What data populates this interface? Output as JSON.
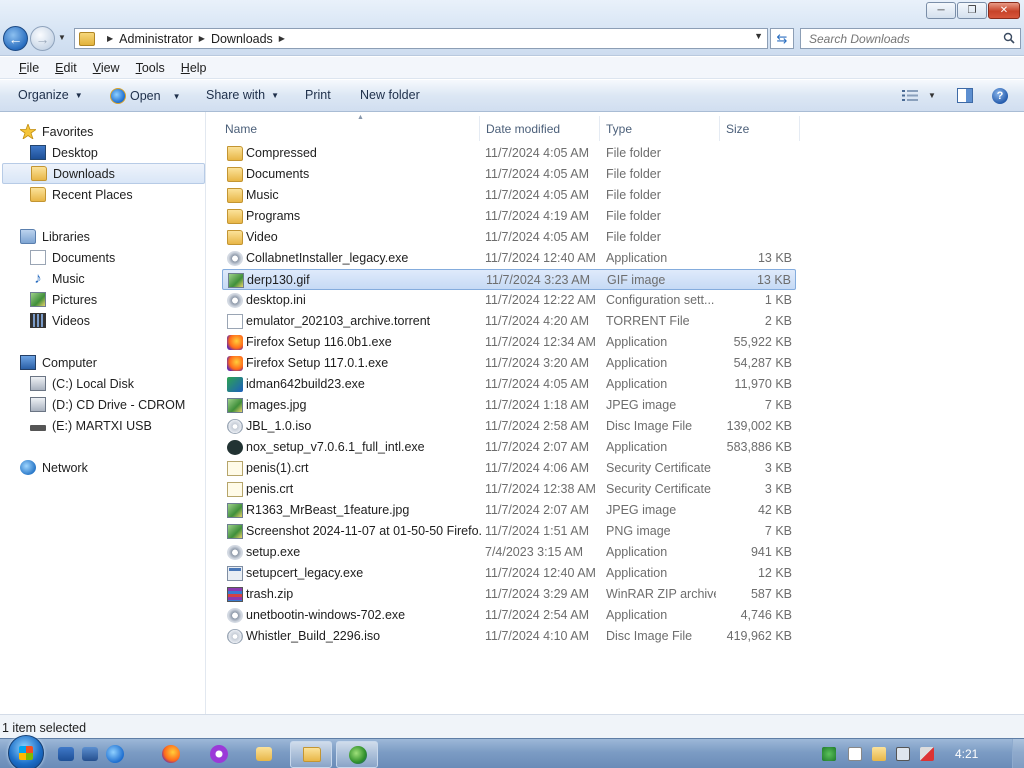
{
  "window": {
    "minimize_label": "─",
    "restore_label": "❐",
    "close_label": "✕"
  },
  "address": {
    "crumbs": [
      "Administrator",
      "Downloads"
    ],
    "search_placeholder": "Search Downloads"
  },
  "menu": {
    "items": [
      {
        "first": "F",
        "rest": "ile"
      },
      {
        "first": "E",
        "rest": "dit"
      },
      {
        "first": "V",
        "rest": "iew"
      },
      {
        "first": "T",
        "rest": "ools"
      },
      {
        "first": "H",
        "rest": "elp"
      }
    ]
  },
  "commands": {
    "organize": "Organize",
    "open": "Open",
    "share": "Share with",
    "print": "Print",
    "new_folder": "New folder"
  },
  "nav": {
    "favorites": "Favorites",
    "desktop": "Desktop",
    "downloads": "Downloads",
    "recent": "Recent Places",
    "libraries": "Libraries",
    "documents": "Documents",
    "music": "Music",
    "pictures": "Pictures",
    "videos": "Videos",
    "computer": "Computer",
    "c_drive": "(C:) Local Disk",
    "d_drive": "(D:) CD Drive - CDROM",
    "e_drive": "(E:) MARTXI USB",
    "network": "Network"
  },
  "columns": {
    "name": "Name",
    "date": "Date modified",
    "type": "Type",
    "size": "Size"
  },
  "files": [
    {
      "name": "Compressed",
      "date": "11/7/2024 4:05 AM",
      "type": "File folder",
      "size": "",
      "icon": "folder"
    },
    {
      "name": "Documents",
      "date": "11/7/2024 4:05 AM",
      "type": "File folder",
      "size": "",
      "icon": "folder"
    },
    {
      "name": "Music",
      "date": "11/7/2024 4:05 AM",
      "type": "File folder",
      "size": "",
      "icon": "folder"
    },
    {
      "name": "Programs",
      "date": "11/7/2024 4:19 AM",
      "type": "File folder",
      "size": "",
      "icon": "folder"
    },
    {
      "name": "Video",
      "date": "11/7/2024 4:05 AM",
      "type": "File folder",
      "size": "",
      "icon": "folder"
    },
    {
      "name": "CollabnetInstaller_legacy.exe",
      "date": "11/7/2024 12:40 AM",
      "type": "Application",
      "size": "13 KB",
      "icon": "gear"
    },
    {
      "name": "derp130.gif",
      "date": "11/7/2024 3:23 AM",
      "type": "GIF image",
      "size": "13 KB",
      "icon": "img",
      "selected": true
    },
    {
      "name": "desktop.ini",
      "date": "11/7/2024 12:22 AM",
      "type": "Configuration sett...",
      "size": "1 KB",
      "icon": "gear"
    },
    {
      "name": "emulator_202103_archive.torrent",
      "date": "11/7/2024 4:20 AM",
      "type": "TORRENT File",
      "size": "2 KB",
      "icon": "doc"
    },
    {
      "name": "Firefox Setup 116.0b1.exe",
      "date": "11/7/2024 12:34 AM",
      "type": "Application",
      "size": "55,922 KB",
      "icon": "fox"
    },
    {
      "name": "Firefox Setup 117.0.1.exe",
      "date": "11/7/2024 3:20 AM",
      "type": "Application",
      "size": "54,287 KB",
      "icon": "fox"
    },
    {
      "name": "idman642build23.exe",
      "date": "11/7/2024 4:05 AM",
      "type": "Application",
      "size": "11,970 KB",
      "icon": "idm"
    },
    {
      "name": "images.jpg",
      "date": "11/7/2024 1:18 AM",
      "type": "JPEG image",
      "size": "7 KB",
      "icon": "img"
    },
    {
      "name": "JBL_1.0.iso",
      "date": "11/7/2024 2:58 AM",
      "type": "Disc Image File",
      "size": "139,002 KB",
      "icon": "disc"
    },
    {
      "name": "nox_setup_v7.0.6.1_full_intl.exe",
      "date": "11/7/2024 2:07 AM",
      "type": "Application",
      "size": "583,886 KB",
      "icon": "nox"
    },
    {
      "name": "penis(1).crt",
      "date": "11/7/2024 4:06 AM",
      "type": "Security Certificate",
      "size": "3 KB",
      "icon": "cert"
    },
    {
      "name": "penis.crt",
      "date": "11/7/2024 12:38 AM",
      "type": "Security Certificate",
      "size": "3 KB",
      "icon": "cert"
    },
    {
      "name": "R1363_MrBeast_1feature.jpg",
      "date": "11/7/2024 2:07 AM",
      "type": "JPEG image",
      "size": "42 KB",
      "icon": "img"
    },
    {
      "name": "Screenshot 2024-11-07 at 01-50-50 Firefo...",
      "date": "11/7/2024 1:51 AM",
      "type": "PNG image",
      "size": "7 KB",
      "icon": "img"
    },
    {
      "name": "setup.exe",
      "date": "7/4/2023 3:15 AM",
      "type": "Application",
      "size": "941 KB",
      "icon": "gear"
    },
    {
      "name": "setupcert_legacy.exe",
      "date": "11/7/2024 12:40 AM",
      "type": "Application",
      "size": "12 KB",
      "icon": "app"
    },
    {
      "name": "trash.zip",
      "date": "11/7/2024 3:29 AM",
      "type": "WinRAR ZIP archive",
      "size": "587 KB",
      "icon": "zip"
    },
    {
      "name": "unetbootin-windows-702.exe",
      "date": "11/7/2024 2:54 AM",
      "type": "Application",
      "size": "4,746 KB",
      "icon": "gear"
    },
    {
      "name": "Whistler_Build_2296.iso",
      "date": "11/7/2024 4:10 AM",
      "type": "Disc Image File",
      "size": "419,962 KB",
      "icon": "disc"
    }
  ],
  "status": {
    "text": "1 item selected"
  },
  "taskbar": {
    "clock": "4:21"
  },
  "colors": {
    "selection": "#c6daf5",
    "accent": "#2a6ec0"
  }
}
